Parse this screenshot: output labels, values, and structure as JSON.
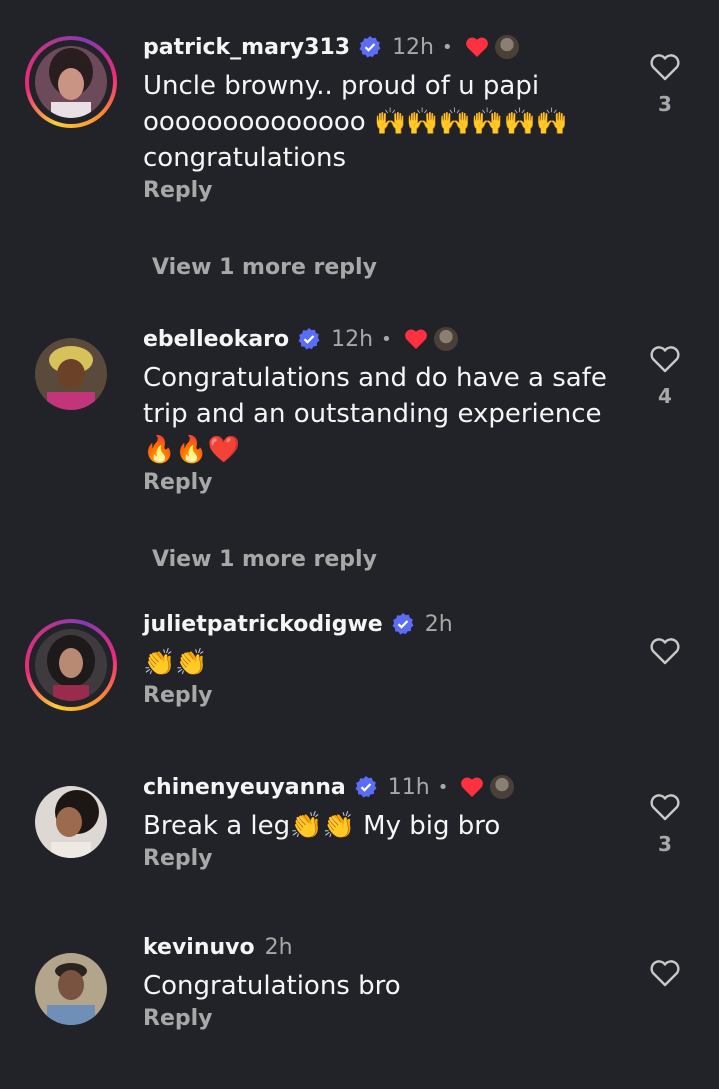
{
  "comments": [
    {
      "username": "patrick_mary313",
      "time": "12h",
      "text": "Uncle browny.. proud of u papi oooooooooooooo 🙌🙌🙌🙌🙌🙌 congratulations",
      "reply_label": "Reply",
      "view_more": "View 1 more reply",
      "likes": "3"
    },
    {
      "username": "ebelleokaro",
      "time": "12h",
      "text": "Congratulations and do have a safe trip and an outstanding experience 🔥🔥❤️",
      "reply_label": "Reply",
      "view_more": "View 1 more reply",
      "likes": "4"
    },
    {
      "username": "julietpatrickodigwe",
      "time": "2h",
      "text": "👏👏",
      "reply_label": "Reply"
    },
    {
      "username": "chinenyeuyanna",
      "time": "11h",
      "text": "Break a leg👏👏 My big bro",
      "reply_label": "Reply",
      "likes": "3"
    },
    {
      "username": "kevinuvo",
      "time": "2h",
      "text": "Congratulations bro",
      "reply_label": "Reply"
    }
  ],
  "icons": {
    "verified": "verified-badge-icon",
    "creator_heart": "red-heart-icon",
    "like": "heart-outline-icon"
  },
  "colors": {
    "background": "#212328",
    "verified": "#5b6cf5",
    "creator_heart": "#ff3040",
    "muted_text": "#a8a8a8"
  },
  "separator": "•"
}
